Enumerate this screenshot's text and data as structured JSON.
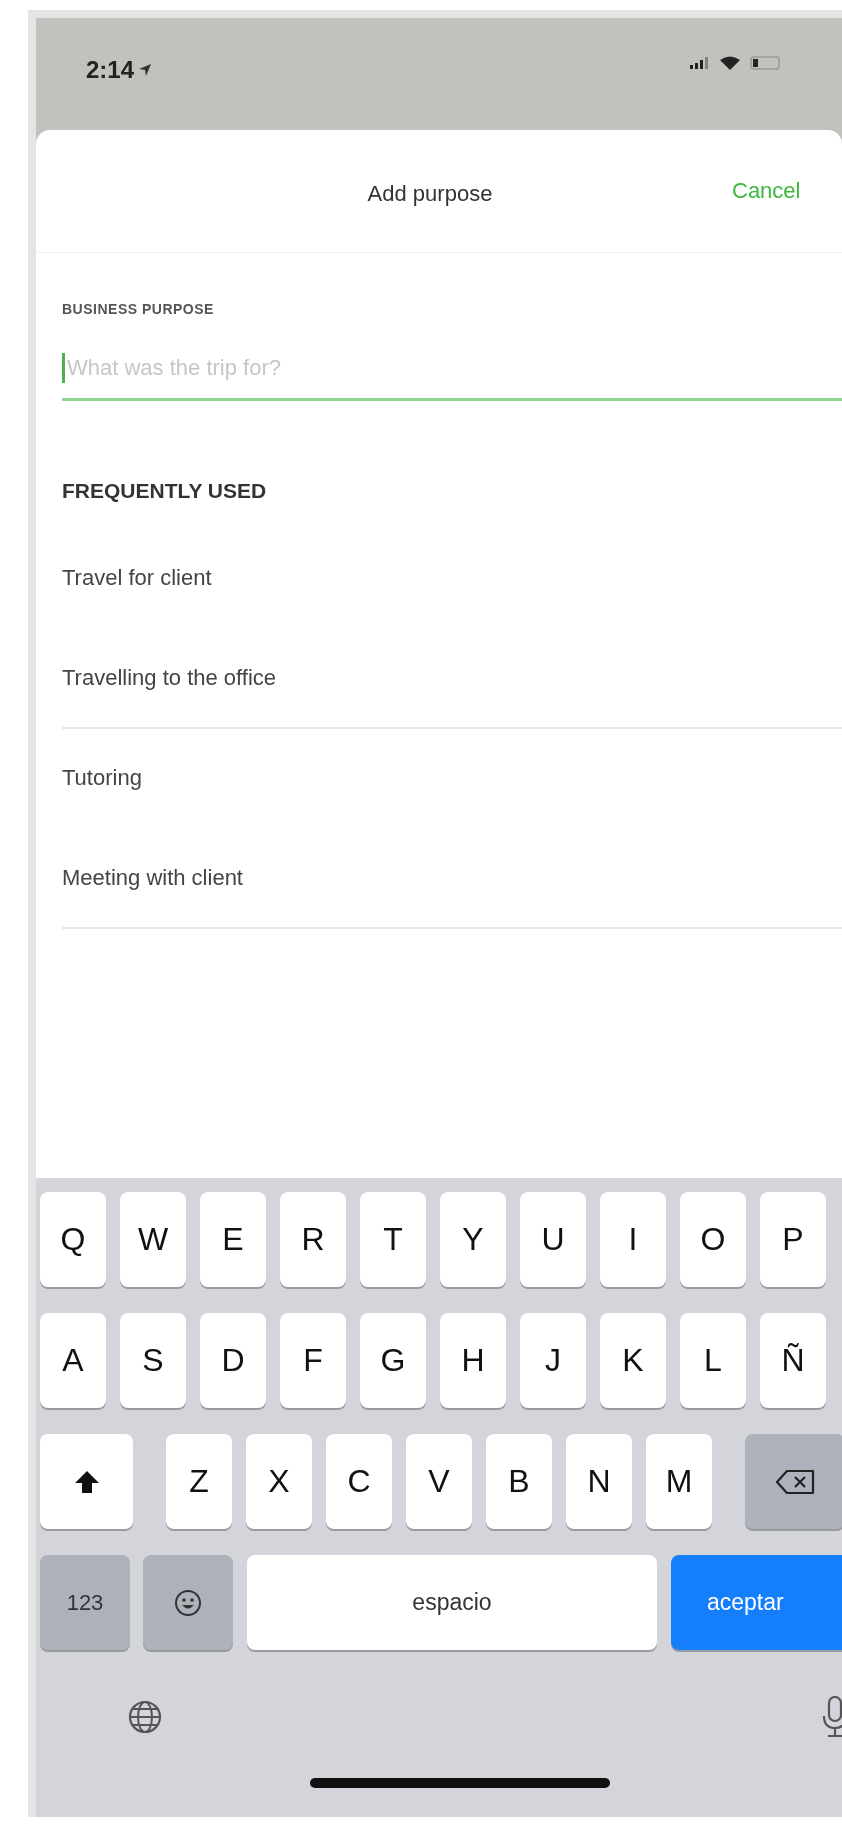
{
  "status_bar": {
    "time": "2:14"
  },
  "nav": {
    "title": "Add purpose",
    "cancel": "Cancel"
  },
  "field": {
    "label": "BUSINESS PURPOSE",
    "placeholder": "What was the trip for?",
    "focused": true
  },
  "section_title": "FREQUENTLY USED",
  "items": [
    {
      "label": "Travel for client",
      "divider": false
    },
    {
      "label": "Travelling to the office",
      "divider": true
    },
    {
      "label": "Tutoring",
      "divider": false
    },
    {
      "label": "Meeting with client",
      "divider": true
    }
  ],
  "keyboard": {
    "rows": [
      [
        {
          "kind": "letter",
          "label": "Q"
        },
        {
          "kind": "letter",
          "label": "W"
        },
        {
          "kind": "letter",
          "label": "E"
        },
        {
          "kind": "letter",
          "label": "R"
        },
        {
          "kind": "letter",
          "label": "T"
        },
        {
          "kind": "letter",
          "label": "Y"
        },
        {
          "kind": "letter",
          "label": "U"
        },
        {
          "kind": "letter",
          "label": "I"
        },
        {
          "kind": "letter",
          "label": "O"
        },
        {
          "kind": "letter",
          "label": "P"
        }
      ],
      [
        {
          "kind": "letter",
          "label": "A"
        },
        {
          "kind": "letter",
          "label": "S"
        },
        {
          "kind": "letter",
          "label": "D"
        },
        {
          "kind": "letter",
          "label": "F"
        },
        {
          "kind": "letter",
          "label": "G"
        },
        {
          "kind": "letter",
          "label": "H"
        },
        {
          "kind": "letter",
          "label": "J"
        },
        {
          "kind": "letter",
          "label": "K"
        },
        {
          "kind": "letter",
          "label": "L"
        },
        {
          "kind": "letter",
          "label": "Ñ"
        }
      ],
      [
        {
          "kind": "shift"
        },
        {
          "kind": "letter",
          "label": "Z"
        },
        {
          "kind": "letter",
          "label": "X"
        },
        {
          "kind": "letter",
          "label": "C"
        },
        {
          "kind": "letter",
          "label": "V"
        },
        {
          "kind": "letter",
          "label": "B"
        },
        {
          "kind": "letter",
          "label": "N"
        },
        {
          "kind": "letter",
          "label": "M"
        },
        {
          "kind": "delete"
        }
      ]
    ],
    "bottom_row": {
      "numbers_key": "123",
      "space_key": "espacio",
      "return_key": "aceptar"
    }
  }
}
